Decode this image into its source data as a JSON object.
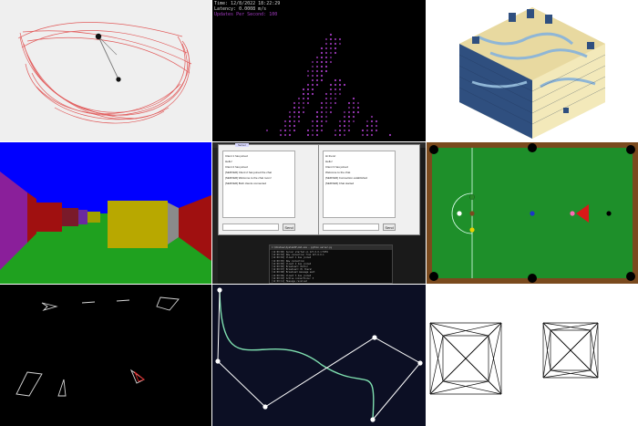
{
  "collage": {
    "tiles": [
      {
        "id": "double-pendulum",
        "label": "Double pendulum trace",
        "background": "#efefef",
        "trace_color": "#e04b4b"
      },
      {
        "id": "matrix-webcam",
        "label": "Particle portrait",
        "background": "#000000",
        "dot_color": "#a23bc0",
        "hud": {
          "time": "Time: 12/8/2022 18:22:29",
          "latency": "Latency: 0.0008 m/s",
          "status": "Updates Per Second: 100"
        }
      },
      {
        "id": "isometric-voxels",
        "label": "Isometric voxel terrain",
        "colors": [
          "#2f4f7f",
          "#f0e7b6",
          "#8fb6d6"
        ]
      },
      {
        "id": "raycaster",
        "label": "Raycaster maze",
        "sky": "#0000ff",
        "floor": "#1fa11f"
      },
      {
        "id": "chat-app",
        "label": "Chat windows",
        "left_window": {
          "tab": "Server",
          "messages": [
            "Client 1 has joined",
            "Hello!",
            "Client 2 has joined",
            "[SERVER] Client 2 has joined the chat",
            "[SERVER] Welcome to the chat room!",
            "[SERVER] Both clients connected"
          ],
          "send": "Send"
        },
        "right_window": {
          "messages": [
            "Hi there!",
            "Hello!",
            "Client 3 has joined",
            "Welcome to the chat",
            "[SERVER] Connection established",
            "[SERVER] Chat started"
          ],
          "send": "Send"
        },
        "console_title": "C:\\Windows\\System32\\cmd.exe - python server.py",
        "console_lines": [
          "[12:00:00] Server started on 127.0.0.1:5555",
          "[12:00:02] New connection from 127.0.0.1",
          "[12:00:02] Client 1 has joined",
          "[12:00:05] New connection",
          "[12:00:05] Client 2 has joined",
          "[12:00:06] Broadcast: Hello!",
          "[12:00:07] Broadcast: Hi there!",
          "[12:00:08] Broadcast message sent",
          "[12:00:09] Client 3 has joined",
          "[12:00:10] Active connections: 3",
          "[12:00:11] Message received",
          "[12:00:12] Message broadcast"
        ]
      },
      {
        "id": "snooker",
        "label": "Snooker table",
        "cloth": "#1e8f2a",
        "cushion": "#7a4a1e"
      },
      {
        "id": "asteroids",
        "label": "Vector polygons",
        "background": "#000000"
      },
      {
        "id": "bezier-editor",
        "label": "Bezier curve editor",
        "background": "#0c0f24",
        "curve_color": "#7fe0b0"
      },
      {
        "id": "wireframe-cubes",
        "label": "Wireframe hypercubes",
        "background": "#ffffff"
      }
    ]
  }
}
